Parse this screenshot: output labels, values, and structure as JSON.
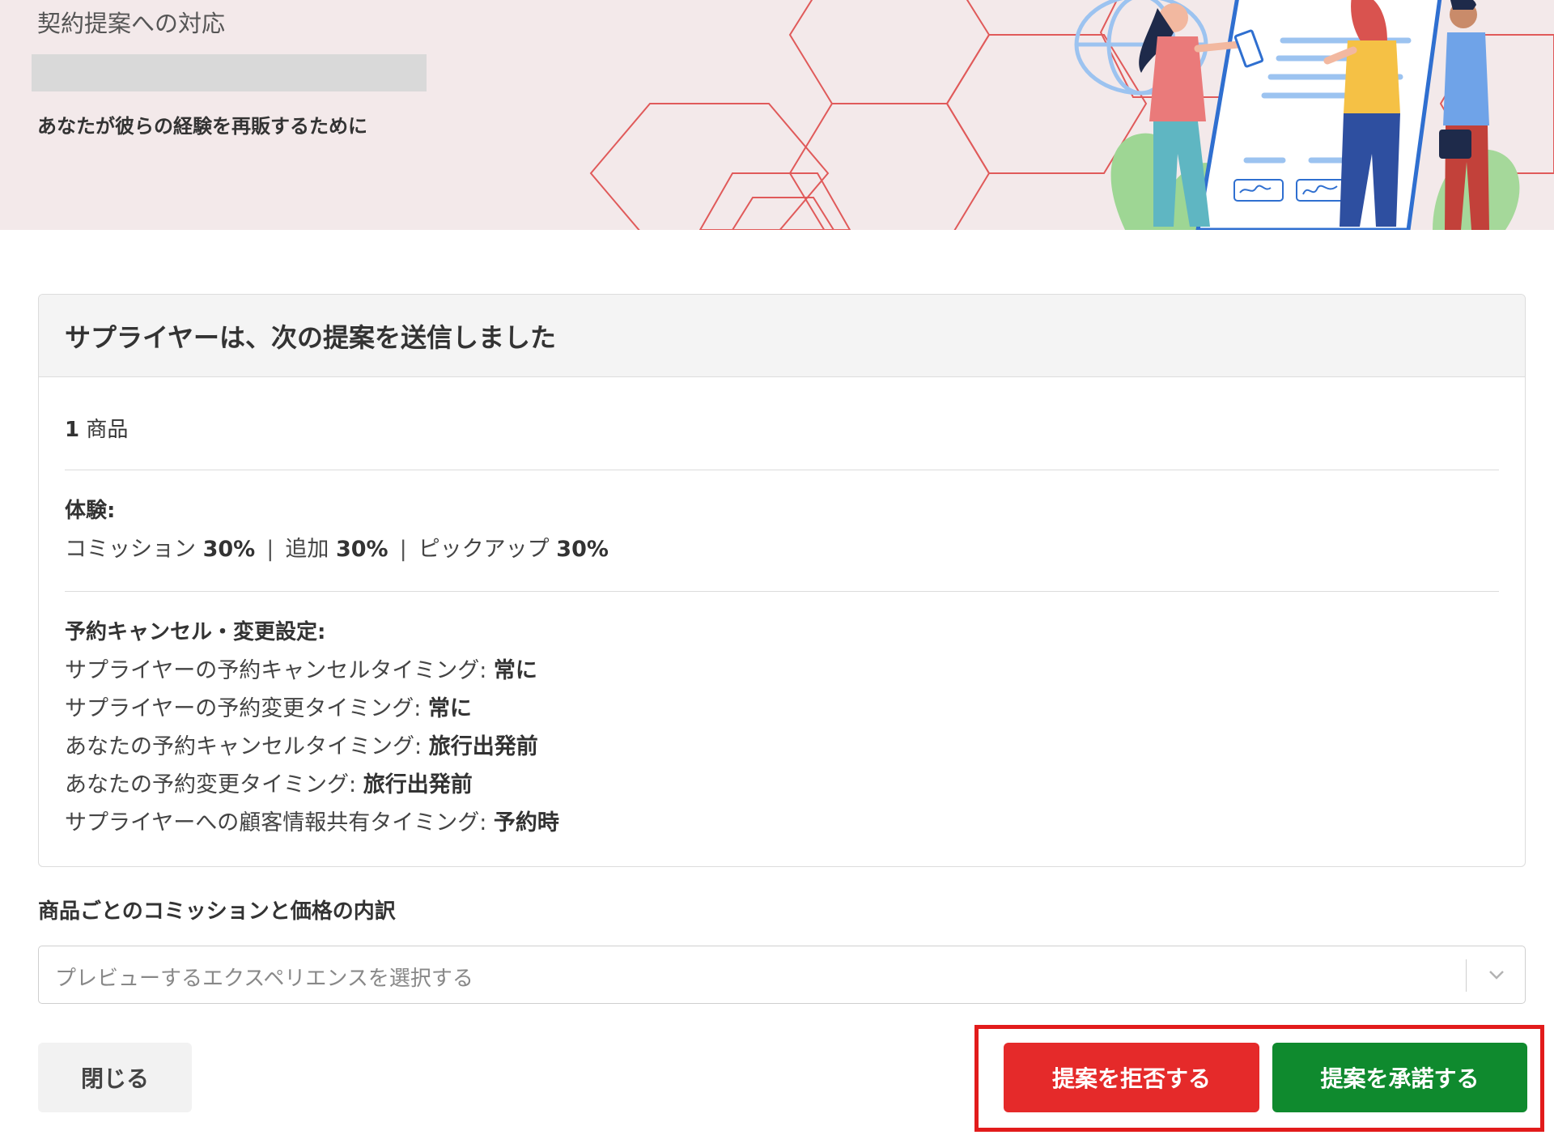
{
  "banner": {
    "title": "契約提案への対応",
    "subtitle": "あなたが彼らの経験を再販するために"
  },
  "proposal": {
    "title": "サプライヤーは、次の提案を送信しました",
    "product_count_number": "1",
    "product_count_unit": "商品",
    "experience": {
      "label": "体験:",
      "items": [
        {
          "name": "コミッション",
          "value": "30%"
        },
        {
          "name": "追加",
          "value": "30%"
        },
        {
          "name": "ピックアップ",
          "value": "30%"
        }
      ],
      "separator": "|"
    },
    "cancellation": {
      "label": "予約キャンセル・変更設定:",
      "rows": [
        {
          "name": "サプライヤーの予約キャンセルタイミング:",
          "value": "常に"
        },
        {
          "name": "サプライヤーの予約変更タイミング:",
          "value": "常に"
        },
        {
          "name": "あなたの予約キャンセルタイミング:",
          "value": "旅行出発前"
        },
        {
          "name": "あなたの予約変更タイミング:",
          "value": "旅行出発前"
        },
        {
          "name": "サプライヤーへの顧客情報共有タイミング:",
          "value": "予約時"
        }
      ]
    }
  },
  "breakdown": {
    "label": "商品ごとのコミッションと価格の内訳",
    "placeholder": "プレビューするエクスペリエンスを選択する"
  },
  "buttons": {
    "close": "閉じる",
    "reject": "提案を拒否する",
    "accept": "提案を承諾する"
  },
  "colors": {
    "banner_bg": "#f3e9ea",
    "hex_stroke": "#e05a5a",
    "reject": "#e52a2a",
    "accept": "#0f8a2e",
    "highlight": "#e21b1b"
  },
  "icons": {
    "select_toggle": "chevron-down-icon"
  }
}
